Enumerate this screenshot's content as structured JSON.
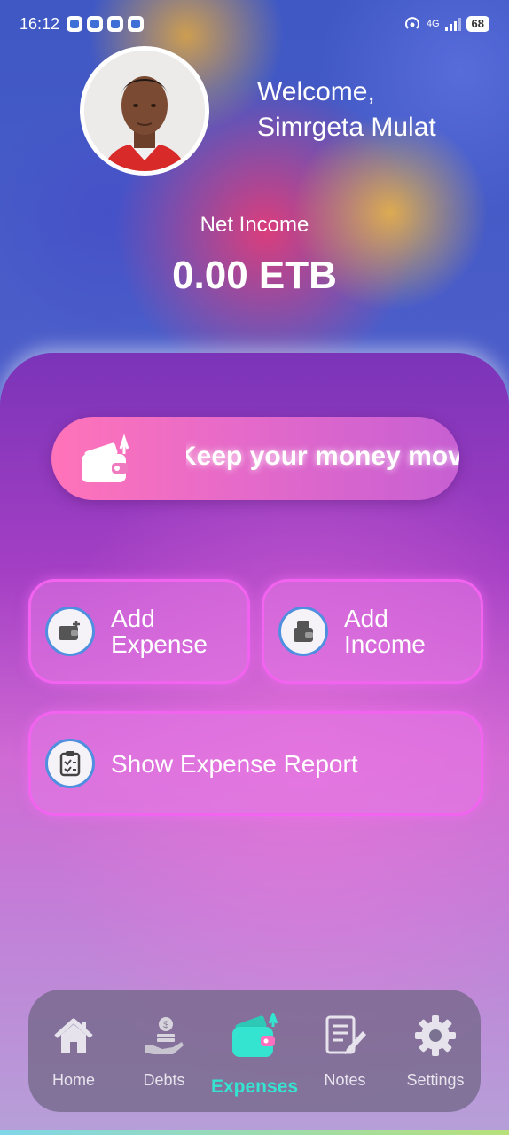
{
  "status_bar": {
    "time": "16:12",
    "network": "4G",
    "battery": "68"
  },
  "header": {
    "welcome": "Welcome,",
    "user_name": "Simrgeta Mulat",
    "net_income_label": "Net Income",
    "net_income_value": "0.00 ETB"
  },
  "banner": {
    "message": "Keep your money movi"
  },
  "actions": {
    "add_expense": "Add\nExpense",
    "add_income": "Add\nIncome",
    "show_report": "Show Expense Report"
  },
  "nav": {
    "home": "Home",
    "debts": "Debts",
    "expenses": "Expenses",
    "notes": "Notes",
    "settings": "Settings",
    "active": "Expenses"
  },
  "colors": {
    "accent": "#34e3d0",
    "card_border": "#f263f0",
    "icon_ring": "#4f8fe0"
  }
}
